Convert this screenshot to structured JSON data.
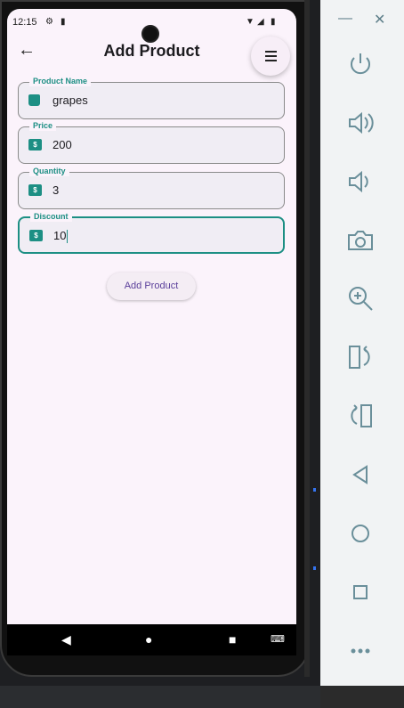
{
  "status_bar": {
    "time": "12:15"
  },
  "app_bar": {
    "title": "Add Product",
    "back_icon": "arrow-left-icon",
    "menu_icon": "hamburger-menu-icon"
  },
  "fields": [
    {
      "label": "Product Name",
      "value": "grapes",
      "icon": "shopping-bag-icon"
    },
    {
      "label": "Price",
      "value": "200",
      "icon": "money-icon"
    },
    {
      "label": "Quantity",
      "value": "3",
      "icon": "money-icon"
    },
    {
      "label": "Discount",
      "value": "10",
      "icon": "money-icon",
      "focused": true
    }
  ],
  "add_button": {
    "label": "Add Product"
  },
  "nav_bar": {
    "icons": [
      "back-triangle-icon",
      "home-circle-icon",
      "recents-square-icon",
      "keyboard-icon"
    ]
  },
  "emulator_panel": {
    "window_controls": [
      "minimize-icon",
      "close-icon"
    ],
    "tools": [
      "power-icon",
      "volume-up-icon",
      "volume-down-icon",
      "camera-icon",
      "zoom-icon",
      "rotate-left-icon",
      "rotate-right-icon",
      "back-icon",
      "home-icon",
      "overview-icon",
      "more-icon"
    ]
  },
  "colors": {
    "accent": "#1d8f84",
    "button_text": "#5a3f9a",
    "screen_bg": "#fbf3fb"
  }
}
